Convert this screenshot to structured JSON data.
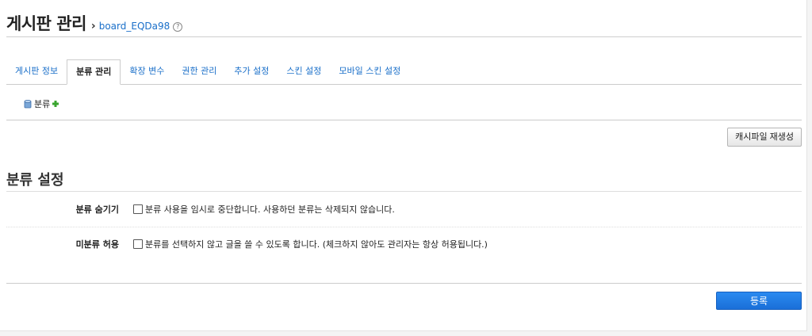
{
  "header": {
    "title": "게시판 관리",
    "separator": "›",
    "board_id": "board_EQDa98",
    "help_glyph": "?"
  },
  "tabs": [
    {
      "label": "게시판 정보",
      "active": false
    },
    {
      "label": "분류 관리",
      "active": true
    },
    {
      "label": "확장 변수",
      "active": false
    },
    {
      "label": "권한 관리",
      "active": false
    },
    {
      "label": "추가 설정",
      "active": false
    },
    {
      "label": "스킨 설정",
      "active": false
    },
    {
      "label": "모바일 스킨 설정",
      "active": false
    }
  ],
  "category_tree": {
    "root_label": "분류",
    "add_icon": "plus-icon",
    "folder_icon": "folder-icon"
  },
  "actions": {
    "cache_button": "캐시파일 재생성",
    "submit_button": "등록"
  },
  "section": {
    "title": "분류 설정",
    "rows": [
      {
        "label": "분류 숨기기",
        "description": "분류 사용을 임시로 중단합니다. 사용하던 분류는 삭제되지 않습니다.",
        "checked": false
      },
      {
        "label": "미분류 허용",
        "description": "분류를 선택하지 않고 글을 쓸 수 있도록 합니다. (체크하지 않아도 관리자는 항상 허용됩니다.)",
        "checked": false
      }
    ]
  },
  "colors": {
    "link": "#1a6fc9",
    "primary_button": "#1a6fd8",
    "add_icon": "#3aa52f"
  }
}
